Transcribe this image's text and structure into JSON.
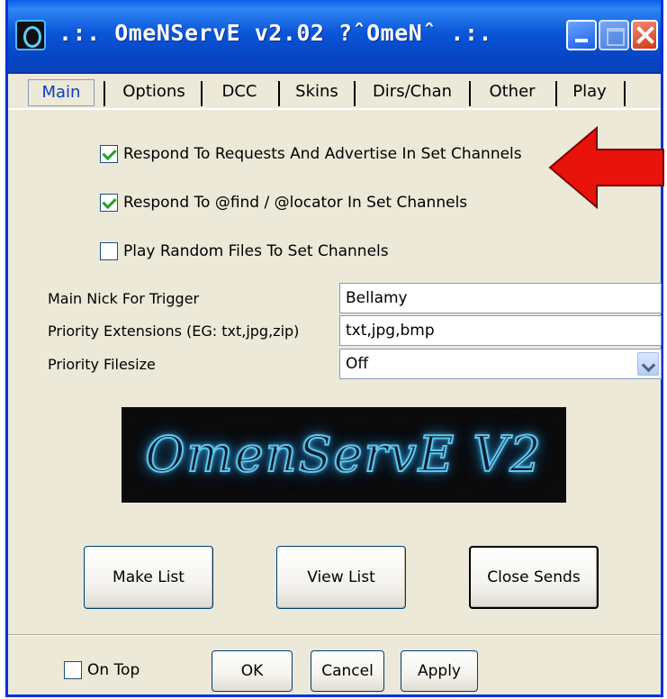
{
  "window": {
    "title": ".:. OmeNServE v2.02 ?ˆOmeNˆ .:."
  },
  "tabs": [
    {
      "label": "Main",
      "active": true
    },
    {
      "label": "Options",
      "active": false
    },
    {
      "label": "DCC",
      "active": false
    },
    {
      "label": "Skins",
      "active": false
    },
    {
      "label": "Dirs/Chan",
      "active": false
    },
    {
      "label": "Other",
      "active": false
    },
    {
      "label": "Play",
      "active": false
    }
  ],
  "options": [
    {
      "label": "Respond To Requests And Advertise In Set Channels",
      "checked": true
    },
    {
      "label": "Respond To @find / @locator In Set Channels",
      "checked": true
    },
    {
      "label": "Play Random Files To Set Channels",
      "checked": false
    }
  ],
  "fields": {
    "main_nick_label": "Main Nick For Trigger",
    "main_nick_value": "Bellamy",
    "priority_ext_label": "Priority Extensions (EG: txt,jpg,zip)",
    "priority_ext_value": "txt,jpg,bmp",
    "priority_filesize_label": "Priority Filesize",
    "priority_filesize_value": "Off"
  },
  "banner": {
    "text": "OmenServE V2"
  },
  "actions": {
    "make_list": "Make List",
    "view_list": "View List",
    "close_sends": "Close Sends"
  },
  "footer": {
    "on_top_label": "On Top",
    "on_top_checked": false,
    "ok": "OK",
    "cancel": "Cancel",
    "apply": "Apply"
  },
  "colors": {
    "titlebar": "#0b56d8",
    "window_bg": "#ece9d8",
    "arrow": "#e8130b",
    "active_tab_text": "#0a3dc2",
    "banner_glow": "#5fc6ef"
  }
}
